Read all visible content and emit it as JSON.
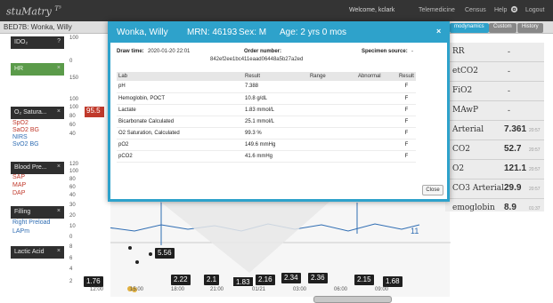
{
  "app": {
    "logo": "stuMatry",
    "logo_mark": "T³",
    "welcome": "Welcome, kclark",
    "nav": [
      "Telemedicine",
      "Census",
      "Help",
      "Logout"
    ]
  },
  "patient_header": {
    "text": "BED7B: Wonka, Willy"
  },
  "right_tabs": [
    "modynamics",
    "Custom",
    "History"
  ],
  "left_panel": {
    "ido2_label": "IDO₂",
    "hr_label": "HR",
    "o2sat": {
      "label": "O₂ Satura...",
      "value": "95.5",
      "sub": [
        "SpO2",
        "SaO2 BG",
        "NIRS",
        "SvO2 BG"
      ]
    },
    "bp": {
      "label": "Blood Pre...",
      "sub": [
        "SAP",
        "MAP",
        "DAP"
      ]
    },
    "filling": {
      "label": "Filling",
      "sub": [
        "Right Preload",
        "LAPm"
      ]
    },
    "lactic": {
      "label": "Lactic Acid"
    }
  },
  "y_ticks": [
    "100",
    "0",
    "150",
    "100",
    "100",
    "80",
    "60",
    "40",
    "120",
    "100",
    "80",
    "60",
    "40",
    "30",
    "20",
    "10",
    "0",
    "8",
    "6",
    "4",
    "2"
  ],
  "right_panel": [
    {
      "label": "RR",
      "value": "-",
      "time": ""
    },
    {
      "label": "etCO2",
      "value": "-",
      "time": ""
    },
    {
      "label": "FiO2",
      "value": "-",
      "time": ""
    },
    {
      "label": "MAwP",
      "value": "-",
      "time": ""
    },
    {
      "label": "Arterial",
      "value": "7.361",
      "time": "20:57"
    },
    {
      "label": "CO2",
      "value": "52.7",
      "time": "20:57"
    },
    {
      "label": "O2",
      "value": "121.1",
      "time": "20:57"
    },
    {
      "label": "CO3 Arterial",
      "value": "29.9",
      "time": "20:57"
    },
    {
      "label": "emoglobin",
      "value": "8.9",
      "time": "01:37"
    }
  ],
  "lab_markers": [
    {
      "label": "1.76"
    },
    {
      "label": "2.22"
    },
    {
      "label": "2.1"
    },
    {
      "label": "1.83"
    },
    {
      "label": "2.16"
    },
    {
      "label": "2.34"
    },
    {
      "label": "2.36"
    },
    {
      "label": "2.15"
    },
    {
      "label": "1.68"
    },
    {
      "label": "5.56"
    }
  ],
  "x_ticks": [
    "12:00",
    "15:00",
    "18:00",
    "21:00",
    "01/21",
    "03:00",
    "06:00",
    "09:00"
  ],
  "chart_inline_value": "11",
  "modal": {
    "patient_name": "Wonka, Willy",
    "mrn": "MRN: 46193",
    "sex": "Sex: M",
    "age": "Age: 2 yrs 0 mos",
    "close_x": "×",
    "draw_time_label": "Draw time:",
    "draw_time": "2020-01-20 22:01",
    "order_label": "Order number:",
    "order_value": "842ef2ee1bc411eaad06448a5b27a2ed",
    "specimen_label": "Specimen source:",
    "specimen_value": "-",
    "columns": [
      "Lab",
      "Result",
      "Range",
      "Abnormal",
      "Result"
    ],
    "rows": [
      {
        "lab": "pH",
        "result": "7.388",
        "range": "",
        "abnormal": "",
        "status": "F"
      },
      {
        "lab": "Hemoglobin, POCT",
        "result": "10.8 g/dL",
        "range": "",
        "abnormal": "",
        "status": "F"
      },
      {
        "lab": "Lactate",
        "result": "1.83 mmol/L",
        "range": "",
        "abnormal": "",
        "status": "F"
      },
      {
        "lab": "Bicarbonate Calculated",
        "result": "25.1 mmol/L",
        "range": "",
        "abnormal": "",
        "status": "F"
      },
      {
        "lab": "O2 Saturation, Calculated",
        "result": "99.3 %",
        "range": "",
        "abnormal": "",
        "status": "F"
      },
      {
        "lab": "pO2",
        "result": "149.6 mmHg",
        "range": "",
        "abnormal": "",
        "status": "F"
      },
      {
        "lab": "pCO2",
        "result": "41.6 mmHg",
        "range": "",
        "abnormal": "",
        "status": "F"
      }
    ],
    "close_button": "Close"
  },
  "colors": {
    "modal_accent": "#2ea2cb",
    "topbar": "#343434",
    "hr_green": "#5b9b4a",
    "red": "#c0392b",
    "blue": "#2f6db3"
  }
}
